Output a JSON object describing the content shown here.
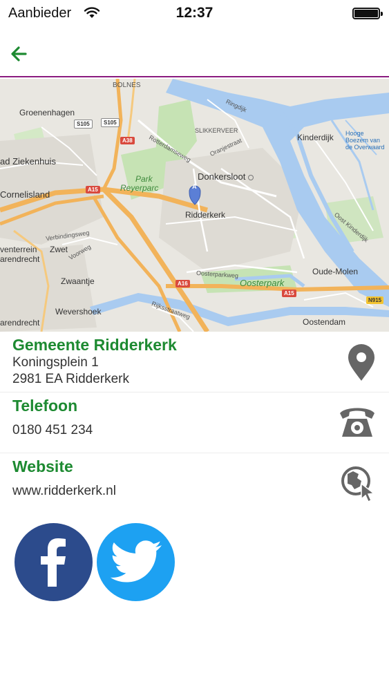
{
  "status_bar": {
    "carrier": "Aanbieder",
    "time": "12:37"
  },
  "nav": {
    "back_icon": "arrow-left-icon"
  },
  "map": {
    "labels": {
      "bolnes": "BOLNES",
      "groenenhagen": "Groenenhagen",
      "ziekenhuis": "ad Ziekenhuis",
      "cornelisland": "Cornelisland",
      "slikkerveer": "SLIKKERVEER",
      "donkersloot": "Donkersloot",
      "kinderdijk": "Kinderdijk",
      "park": "Park",
      "reyerparc": "Reyerparc",
      "ridderkerk": "Ridderkerk",
      "zwet": "Zwet",
      "venterrein": "venterrein",
      "arendrecht": "arendrecht",
      "zwaantje": "Zwaantje",
      "oostendam": "Oostendam",
      "oude_molen": "Oude-Molen",
      "wevershoek": "Wevershoek",
      "arendrecht2": "arendrecht",
      "oosterpark": "Oosterpark",
      "hooge_boezem": "Hooge Boezem van de Overwaard",
      "oost_kinderdijk": "Oost Kinderdijk",
      "rotterdamseweg": "Rotterdamseweg",
      "verbindingsweg": "Verbindingsweg",
      "voorweg": "Voorweg",
      "oosterparkweg": "Oosterparkweg",
      "rijksstraatweg": "Rijksstraatweg",
      "ringdijk": "Ringdijk",
      "oranjestraat": "Oranjestraat"
    },
    "shields": {
      "s105a": "S105",
      "s105b": "S105",
      "a38": "A38",
      "a15a": "A15",
      "a16": "A16",
      "a15b": "A15",
      "n915": "N915"
    },
    "marker_label": "A"
  },
  "contact": {
    "name": "Gemeente Ridderkerk",
    "address_line1": "Koningsplein 1",
    "address_line2": "2981 EA Ridderkerk",
    "phone_title": "Telefoon",
    "phone": "0180 451 234",
    "website_title": "Website",
    "website": "www.ridderkerk.nl"
  },
  "colors": {
    "accent_green": "#1d8a31",
    "nav_border": "#8a1a7e",
    "facebook": "#2c4b8c",
    "twitter": "#1da1f2"
  }
}
